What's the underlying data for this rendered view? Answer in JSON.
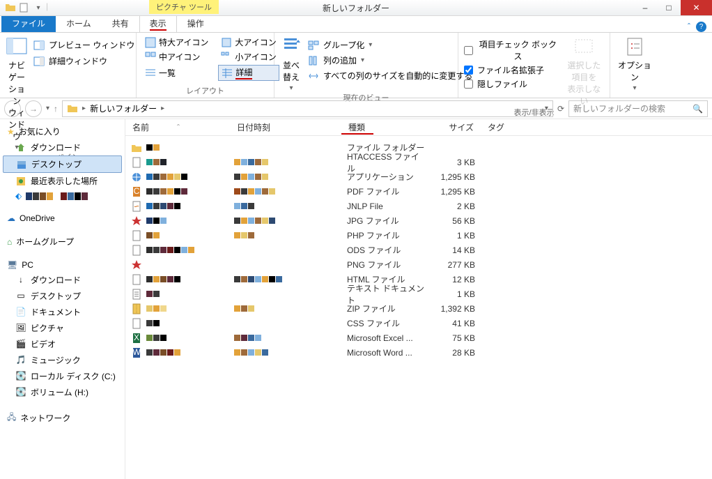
{
  "titlebar": {
    "title": "新しいフォルダー",
    "tools_badge": "ピクチャ ツール"
  },
  "tabs": {
    "file": "ファイル",
    "items": [
      "ホーム",
      "共有",
      "表示",
      "操作"
    ],
    "active": 2,
    "underlined": 2
  },
  "ribbon": {
    "pane_group": {
      "nav": "ナビゲーション\nウィンドウ",
      "preview": "プレビュー ウィンドウ",
      "detail_pane": "詳細ウィンドウ",
      "label": "ペイン"
    },
    "layout_group": {
      "items": [
        "特大アイコン",
        "大アイコン",
        "中アイコン",
        "小アイコン",
        "一覧",
        "詳細"
      ],
      "selected": 5,
      "label": "レイアウト"
    },
    "view_group": {
      "sort": "並べ替え",
      "group": "グループ化",
      "addcol": "列の追加",
      "autofit": "すべての列のサイズを自動的に変更する",
      "label": "現在のビュー"
    },
    "showhide_group": {
      "checks": [
        {
          "label": "項目チェック ボックス",
          "checked": false
        },
        {
          "label": "ファイル名拡張子",
          "checked": true
        },
        {
          "label": "隠しファイル",
          "checked": false
        }
      ],
      "hide_btn": "選択した項目を\n表示しない",
      "label": "表示/非表示"
    },
    "options_group": {
      "options": "オプション"
    }
  },
  "address": {
    "path": "新しいフォルダー",
    "search_placeholder": "新しいフォルダーの検索"
  },
  "sidebar": {
    "favorites": {
      "label": "お気に入り",
      "items": [
        "ダウンロード",
        "デスクトップ",
        "最近表示した場所"
      ],
      "selected": 1
    },
    "onedrive": "OneDrive",
    "homegroup": "ホームグループ",
    "pc": {
      "label": "PC",
      "items": [
        "ダウンロード",
        "デスクトップ",
        "ドキュメント",
        "ピクチャ",
        "ビデオ",
        "ミュージック",
        "ローカル ディスク (C:)",
        "ボリューム (H:)"
      ]
    },
    "network": "ネットワーク"
  },
  "columns": {
    "name": "名前",
    "date": "日付時刻",
    "type": "種類",
    "size": "サイズ",
    "tag": "タグ",
    "underlined": "type"
  },
  "files": [
    {
      "icon": "folder",
      "type": "ファイル フォルダー",
      "size": ""
    },
    {
      "icon": "file",
      "type": "HTACCESS ファイル",
      "size": "3 KB"
    },
    {
      "icon": "globe",
      "type": "アプリケーション",
      "size": "1,295 KB"
    },
    {
      "icon": "pdf",
      "type": "PDF ファイル",
      "size": "1,295 KB"
    },
    {
      "icon": "java",
      "type": "JNLP File",
      "size": "2 KB"
    },
    {
      "icon": "img",
      "type": "JPG ファイル",
      "size": "56 KB"
    },
    {
      "icon": "file",
      "type": "PHP ファイル",
      "size": "1 KB"
    },
    {
      "icon": "file",
      "type": "ODS ファイル",
      "size": "14 KB"
    },
    {
      "icon": "img",
      "type": "PNG ファイル",
      "size": "277 KB"
    },
    {
      "icon": "file",
      "type": "HTML ファイル",
      "size": "12 KB"
    },
    {
      "icon": "txt",
      "type": "テキスト ドキュメント",
      "size": "1 KB"
    },
    {
      "icon": "zip",
      "type": "ZIP ファイル",
      "size": "1,392 KB"
    },
    {
      "icon": "file",
      "type": "CSS ファイル",
      "size": "41 KB"
    },
    {
      "icon": "excel",
      "type": "Microsoft Excel ...",
      "size": "75 KB"
    },
    {
      "icon": "word",
      "type": "Microsoft Word ...",
      "size": "28 KB"
    }
  ],
  "mosaic_palettes": [
    [
      "#000",
      "#e2a23a"
    ],
    [
      "#1a9b8f",
      "#9e6a3a",
      "#20232a"
    ],
    [
      "#1f6ab0",
      "#3a3a3a",
      "#9e6a3a",
      "#e2a23a",
      "#e5c76b",
      "#000"
    ],
    [
      "#2d2d2d",
      "#3a3a3a",
      "#9e6a3a",
      "#e2a23a",
      "#000",
      "#5e2a3a"
    ],
    [
      "#1f6ab0",
      "#3a3a3a",
      "#2d4a72",
      "#5e2a3a",
      "#000"
    ],
    [
      "#1f3a6a",
      "#000",
      "#7fb0dd"
    ],
    [
      "#7a4e27",
      "#e2a23a"
    ],
    [
      "#2d2d2d",
      "#3a3a3a",
      "#5e2a3a",
      "#6a1b1b",
      "#000",
      "#7fb0dd",
      "#e2a23a"
    ],
    [],
    [
      "#2d2d2d",
      "#e2a23a",
      "#7a4e27",
      "#5e2a3a",
      "#000"
    ],
    [
      "#5e2a3a",
      "#3a3a3a"
    ],
    [
      "#e5c76b",
      "#e2a23a",
      "#f0d78c"
    ],
    [
      "#3a3a3a",
      "#000"
    ],
    [
      "#6a8a3a",
      "#3a3a3a",
      "#000"
    ],
    [
      "#3a3a3a",
      "#5e2a3a",
      "#7a4e27",
      "#6a1b1b",
      "#e2a23a"
    ]
  ],
  "date_palettes": [
    [],
    [
      "#e2a23a",
      "#7fb0dd",
      "#3a6a9e",
      "#9e6a3a",
      "#e5c76b"
    ],
    [
      "#3a3a3a",
      "#e2a23a",
      "#7fb0dd",
      "#9e6a3a",
      "#e5c76b"
    ],
    [
      "#9e4a1a",
      "#3a3a3a",
      "#e2a23a",
      "#7fb0dd",
      "#9e6a3a",
      "#e5c76b"
    ],
    [
      "#7fb0dd",
      "#3a6a9e",
      "#3a3a3a"
    ],
    [
      "#3a3a3a",
      "#e2a23a",
      "#7fb0dd",
      "#9e6a3a",
      "#e5c76b",
      "#2d4a72"
    ],
    [
      "#e2a23a",
      "#e5c76b",
      "#9e6a3a"
    ],
    [],
    [],
    [
      "#3a3a3a",
      "#9e6a3a",
      "#2d4a72",
      "#7fb0dd",
      "#e2a23a",
      "#000",
      "#3a6a9e"
    ],
    [],
    [
      "#e2a23a",
      "#9e6a3a",
      "#e5c76b"
    ],
    [],
    [
      "#9e6a3a",
      "#5e2a3a",
      "#3a6a9e",
      "#7fb0dd"
    ],
    [
      "#e2a23a",
      "#9e6a3a",
      "#7fb0dd",
      "#e5c76b",
      "#3a6a9e"
    ]
  ]
}
